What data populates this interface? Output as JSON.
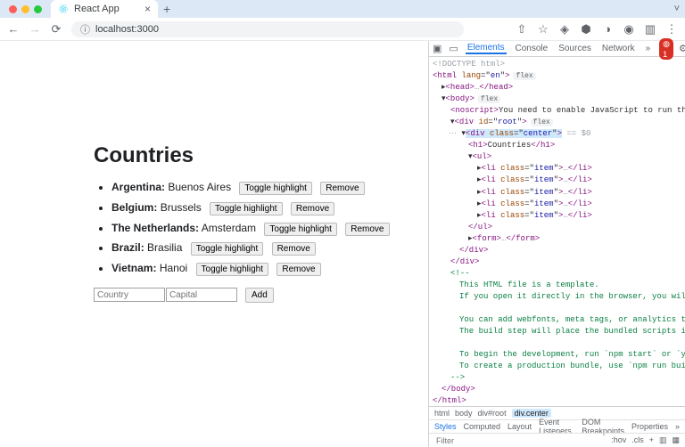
{
  "browser": {
    "tab": {
      "title": "React App",
      "favicon_color": "#61dafb"
    },
    "address": "localhost:3000"
  },
  "page": {
    "heading": "Countries",
    "countries": [
      {
        "name": "Argentina",
        "capital": "Buenos Aires"
      },
      {
        "name": "Belgium",
        "capital": "Brussels"
      },
      {
        "name": "The Netherlands",
        "capital": "Amsterdam"
      },
      {
        "name": "Brazil",
        "capital": "Brasilia"
      },
      {
        "name": "Vietnam",
        "capital": "Hanoi"
      }
    ],
    "buttons": {
      "toggle": "Toggle highlight",
      "remove": "Remove",
      "add": "Add"
    },
    "form": {
      "country_placeholder": "Country",
      "capital_placeholder": "Capital"
    }
  },
  "devtools": {
    "tabs": [
      "Elements",
      "Console",
      "Sources",
      "Network"
    ],
    "active_tab": "Elements",
    "errors_count": "1",
    "dom_text": {
      "doctype": "<!DOCTYPE html>",
      "html_open": "<html lang=\"en\">",
      "head": "<head>…</head>",
      "body_open": "<body>",
      "noscript": "You need to enable JavaScript to run this app.",
      "root_open": "<div id=\"root\">",
      "center_open": "<div class=\"center\">",
      "h1": "Countries",
      "ul_open": "<ul>",
      "li": "<li class=\"item\">…</li>",
      "ul_close": "</ul>",
      "form": "<form>…</form>",
      "div_close": "</div>",
      "comment_l1": "This HTML file is a template.",
      "comment_l2": "If you open it directly in the browser, you will see an empty page.",
      "comment_l3": "You can add webfonts, meta tags, or analytics to this file.",
      "comment_l4": "The build step will place the bundled scripts into the <body> tag.",
      "comment_l5": "To begin the development, run `npm start` or `yarn start`.",
      "comment_l6": "To create a production bundle, use `npm run build` or `yarn build`.",
      "body_close": "</body>",
      "html_close": "</html>",
      "pill_flex": "flex",
      "sel_eq": " == $0"
    },
    "crumbs": [
      "html",
      "body",
      "div#root",
      "div.center"
    ],
    "styles_tabs": [
      "Styles",
      "Computed",
      "Layout",
      "Event Listeners",
      "DOM Breakpoints",
      "Properties"
    ],
    "filter_placeholder": "Filter",
    "filter_right": [
      ":hov",
      ".cls",
      "+"
    ]
  }
}
